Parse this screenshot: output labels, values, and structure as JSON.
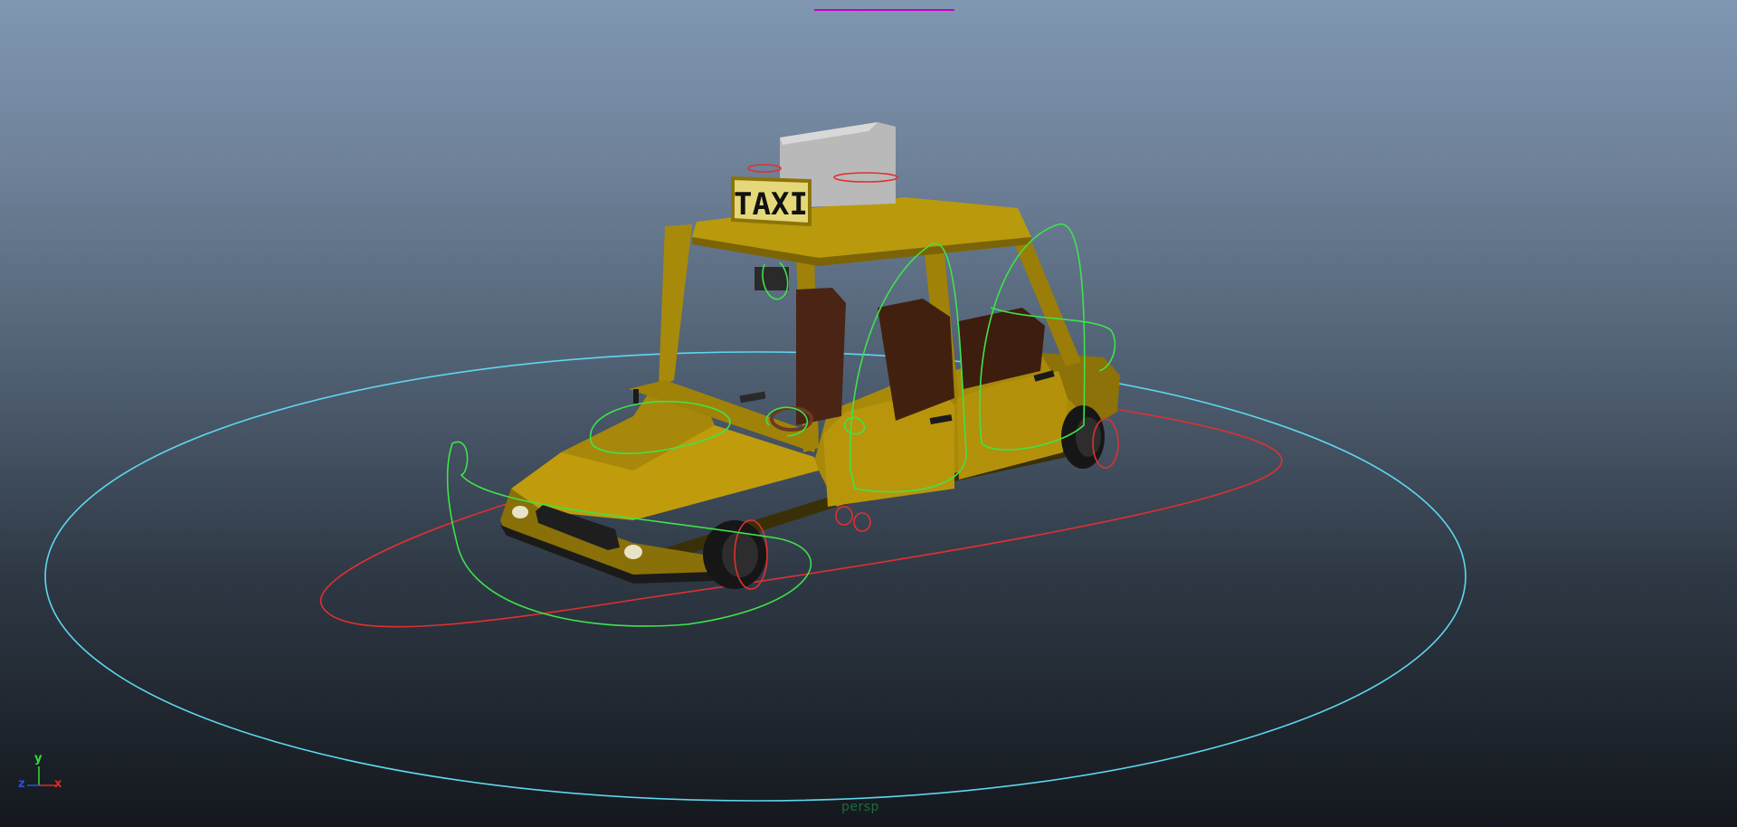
{
  "viewport": {
    "camera_name": "persp",
    "taxi_sign_text": "TAXI",
    "axis_labels": {
      "y": "y",
      "x": "x",
      "z": "z"
    }
  },
  "colors": {
    "root_control": "#5fd6ee",
    "red_controls": "#e03030",
    "green_controls": "#3ee34a",
    "top_marker": "#c400c8",
    "car_body": "#b8960a",
    "car_body_shadow": "#7a6205",
    "seat": "#4a2414",
    "tire": "#161616",
    "sign_box": "#b9b9b9"
  }
}
